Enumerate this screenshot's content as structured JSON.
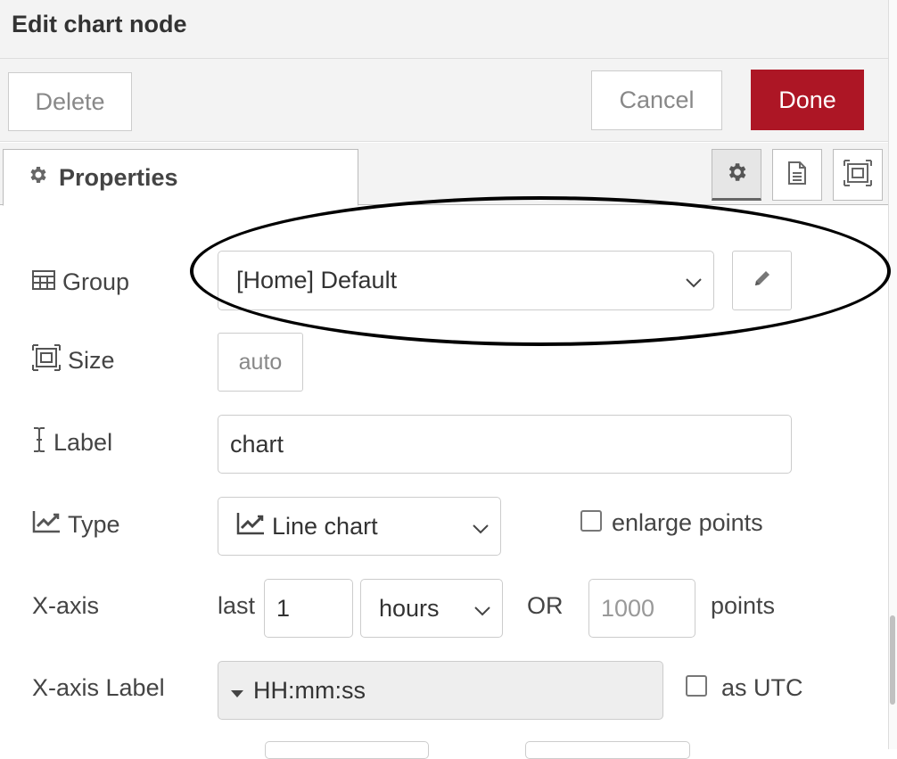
{
  "dialog": {
    "title": "Edit chart node"
  },
  "toolbar": {
    "delete_label": "Delete",
    "cancel_label": "Cancel",
    "done_label": "Done"
  },
  "tabs": {
    "properties_label": "Properties"
  },
  "form": {
    "group": {
      "label": "Group",
      "value": "[Home] Default"
    },
    "size": {
      "label": "Size",
      "value": "auto"
    },
    "label_field": {
      "label": "Label",
      "value": "chart"
    },
    "type": {
      "label": "Type",
      "value": "Line chart",
      "enlarge_points_label": "enlarge points",
      "enlarge_points_checked": false
    },
    "xaxis": {
      "label": "X-axis",
      "last_label": "last",
      "last_value": "1",
      "unit": "hours",
      "or_label": "OR",
      "points_placeholder": "1000",
      "points_label": "points"
    },
    "xaxis_label": {
      "label": "X-axis Label",
      "value": "HH:mm:ss",
      "as_utc_label": "as UTC",
      "as_utc_checked": false
    }
  },
  "colors": {
    "primary_button": "#ad1625",
    "header_bg": "#f3f3f3",
    "border": "#cccccc"
  },
  "icons": [
    "gear-icon",
    "document-icon",
    "frame-icon",
    "table-icon",
    "resize-icon",
    "text-cursor-icon",
    "line-chart-icon",
    "pencil-icon",
    "chevron-down-icon",
    "caret-down-icon"
  ]
}
